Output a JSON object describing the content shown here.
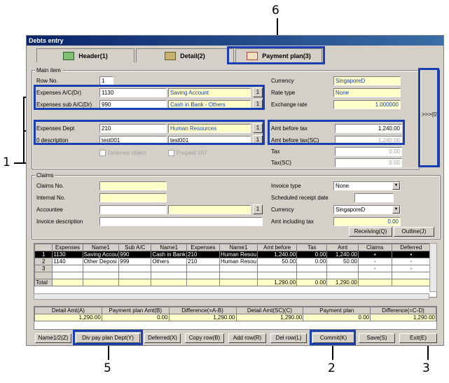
{
  "window_title": "Debts entry",
  "tabs": [
    {
      "label": "Header(1)"
    },
    {
      "label": "Detail(2)"
    },
    {
      "label": "Payment plan(3)"
    }
  ],
  "callouts": {
    "c1": "1",
    "c2": "2",
    "c3": "3",
    "c5": "5",
    "c6": "6"
  },
  "main": {
    "group_label": "Main item",
    "row_no_label": "Row No.",
    "row_no": "1",
    "exp_ac_label": "Expenses A/C(Dr)",
    "exp_ac": "1130",
    "exp_ac_name": "Saving Account",
    "exp_sub_label": "Expenses sub A/C(Dr)",
    "exp_sub": "990",
    "exp_sub_name": "Cash in Bank - Others",
    "exp_dept_label": "Expenses Dept",
    "exp_dept": "210",
    "exp_dept_name": "Human Resources",
    "desc_label": "0 description",
    "desc": "test001",
    "desc2": "test001",
    "deferred_label": "Deferred object",
    "prepaid_label": "Prepaid VAT",
    "currency_label": "Currency",
    "currency": "SingaporeD",
    "rate_type_label": "Rate type",
    "rate_type": "None",
    "exch_label": "Exchange rate",
    "exch": "1.000000",
    "amt_before_label": "Amt before tax",
    "amt_before": "1,240.00",
    "amt_before_sc_label": "Amt before tax(SC)",
    "amt_before_sc": "1,240.00",
    "tax_label": "Tax",
    "tax": "0.00",
    "tax_sc_label": "Tax(SC)",
    "tax_sc": "0.00",
    "one": "1",
    "side_btn": ">>>(0)"
  },
  "claims": {
    "group_label": "Claims",
    "claims_no_label": "Claims No.",
    "internal_no_label": "Internal No.",
    "accountee_label": "Accountee",
    "inv_desc_label": "Invoice description",
    "inv_type_label": "Invoice type",
    "inv_type": "None",
    "sched_label": "Scheduled receipt date",
    "currency_label": "Currency",
    "currency": "SingaporeD",
    "amt_incl_label": "Amt including tax",
    "amt_incl": "0.00",
    "receiving": "Receiving(Q)",
    "outline": "Outline(J)"
  },
  "grid": {
    "headers": [
      "",
      "Expenses",
      "Name1",
      "Sub A/C",
      "Name1",
      "Expenses",
      "Name1",
      "Amt before",
      "Tax",
      "Amt",
      "Claims",
      "Deferred"
    ],
    "rows": [
      [
        "1",
        "1130",
        "Saving Accou",
        "990",
        "Cash in Bank",
        "210",
        "Human Resou",
        "1,240.00",
        "0.00",
        "1,240.00",
        "",
        ""
      ],
      [
        "2",
        "1140",
        "Other Deposi",
        "999",
        "Others",
        "210",
        "Human Resou",
        "50.00",
        "0.00",
        "50.00",
        "",
        ""
      ],
      [
        "3",
        "",
        "",
        "",
        "",
        "",
        "",
        "",
        "",
        "",
        "",
        ""
      ]
    ],
    "total": [
      "Total",
      "",
      "",
      "",
      "",
      "",
      "",
      "1,290.00",
      "0.00",
      "1,290.00",
      "",
      ""
    ]
  },
  "summary": {
    "headers": [
      "Detail Amt(A)",
      "Payment plan Amt(B)",
      "Difference(=A-B)",
      "Detail Amt(SC)(C)",
      "Payment plan",
      "Difference(=C-D)"
    ],
    "values": [
      "1,290.00",
      "0.00",
      "1,290.00",
      "1,290.00",
      "0.00",
      "1,290.00"
    ]
  },
  "buttons": [
    "Name1/2(Z)",
    "Div pay plan Dept(Y)",
    "Deferred(X)",
    "Copy row(B)",
    "Add row(R)",
    "Del row(L)",
    "Commit(K)",
    "Save(S)",
    "Exit(E)"
  ]
}
